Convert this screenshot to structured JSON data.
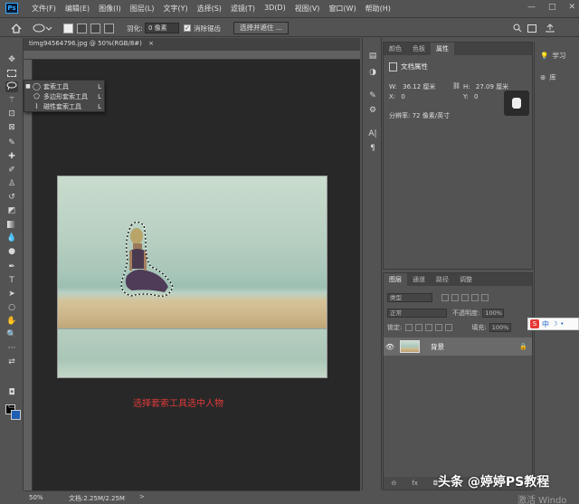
{
  "app": {
    "logo": "Ps"
  },
  "menu": [
    "文件(F)",
    "编辑(E)",
    "图像(I)",
    "图层(L)",
    "文字(Y)",
    "选择(S)",
    "滤镜(T)",
    "3D(D)",
    "视图(V)",
    "窗口(W)",
    "帮助(H)"
  ],
  "window_controls": {
    "minimize": "—",
    "maximize": "□",
    "close": "✕"
  },
  "options_bar": {
    "feather_label": "羽化:",
    "feather_value": "0 像素",
    "antialias_label": "消除锯齿",
    "antialias_checked": true,
    "select_mask_label": "选择并遮住 ..."
  },
  "document": {
    "tab_title": "timg94564796.jpg @ 50%(RGB/8#)",
    "tab_close": "×"
  },
  "flyout": {
    "items": [
      {
        "label": "套索工具",
        "key": "L",
        "icon": "lasso-icon",
        "selected": true
      },
      {
        "label": "多边形套索工具",
        "key": "L",
        "icon": "polygonal-lasso-icon",
        "selected": false
      },
      {
        "label": "磁性套索工具",
        "key": "L",
        "icon": "magnetic-lasso-icon",
        "selected": false
      }
    ]
  },
  "annotation": "选择套索工具选中人物",
  "status": {
    "zoom": "50%",
    "doc_size": "文档:2.25M/2.25M",
    "arrow": ">"
  },
  "properties_panel": {
    "tabs": [
      "颜色",
      "色板",
      "属性"
    ],
    "active_tab": "属性",
    "title": "文档属性",
    "w_label": "W:",
    "w_value": "36.12 厘米",
    "h_label": "H:",
    "h_value": "27.09 厘米",
    "x_label": "X:",
    "x_value": "0",
    "y_label": "Y:",
    "y_value": "0",
    "resolution": "分辨率: 72 像素/英寸"
  },
  "layers_panel": {
    "tabs": [
      "图层",
      "通道",
      "路径",
      "调整"
    ],
    "active_tab": "图层",
    "kind_label": "类型",
    "blend_mode": "正常",
    "opacity_label": "不透明度:",
    "opacity_value": "100%",
    "lock_label": "锁定:",
    "fill_label": "填充:",
    "fill_value": "100%",
    "layer_name": "背景",
    "footer_icons": [
      "link-icon",
      "fx-icon",
      "mask-icon",
      "adjustment-icon",
      "folder-icon",
      "new-layer-icon",
      "trash-icon"
    ],
    "footer_text": [
      "⊝",
      "fx",
      "◘",
      "◐",
      "▭",
      "⊞",
      "🗑"
    ]
  },
  "right_column": {
    "learn": "学习",
    "library": "库"
  },
  "ime": {
    "zh": "中",
    "moon": "☽",
    "dot": "•"
  },
  "watermark": "头条 @婷婷PS教程",
  "activate": "激活 Windo"
}
